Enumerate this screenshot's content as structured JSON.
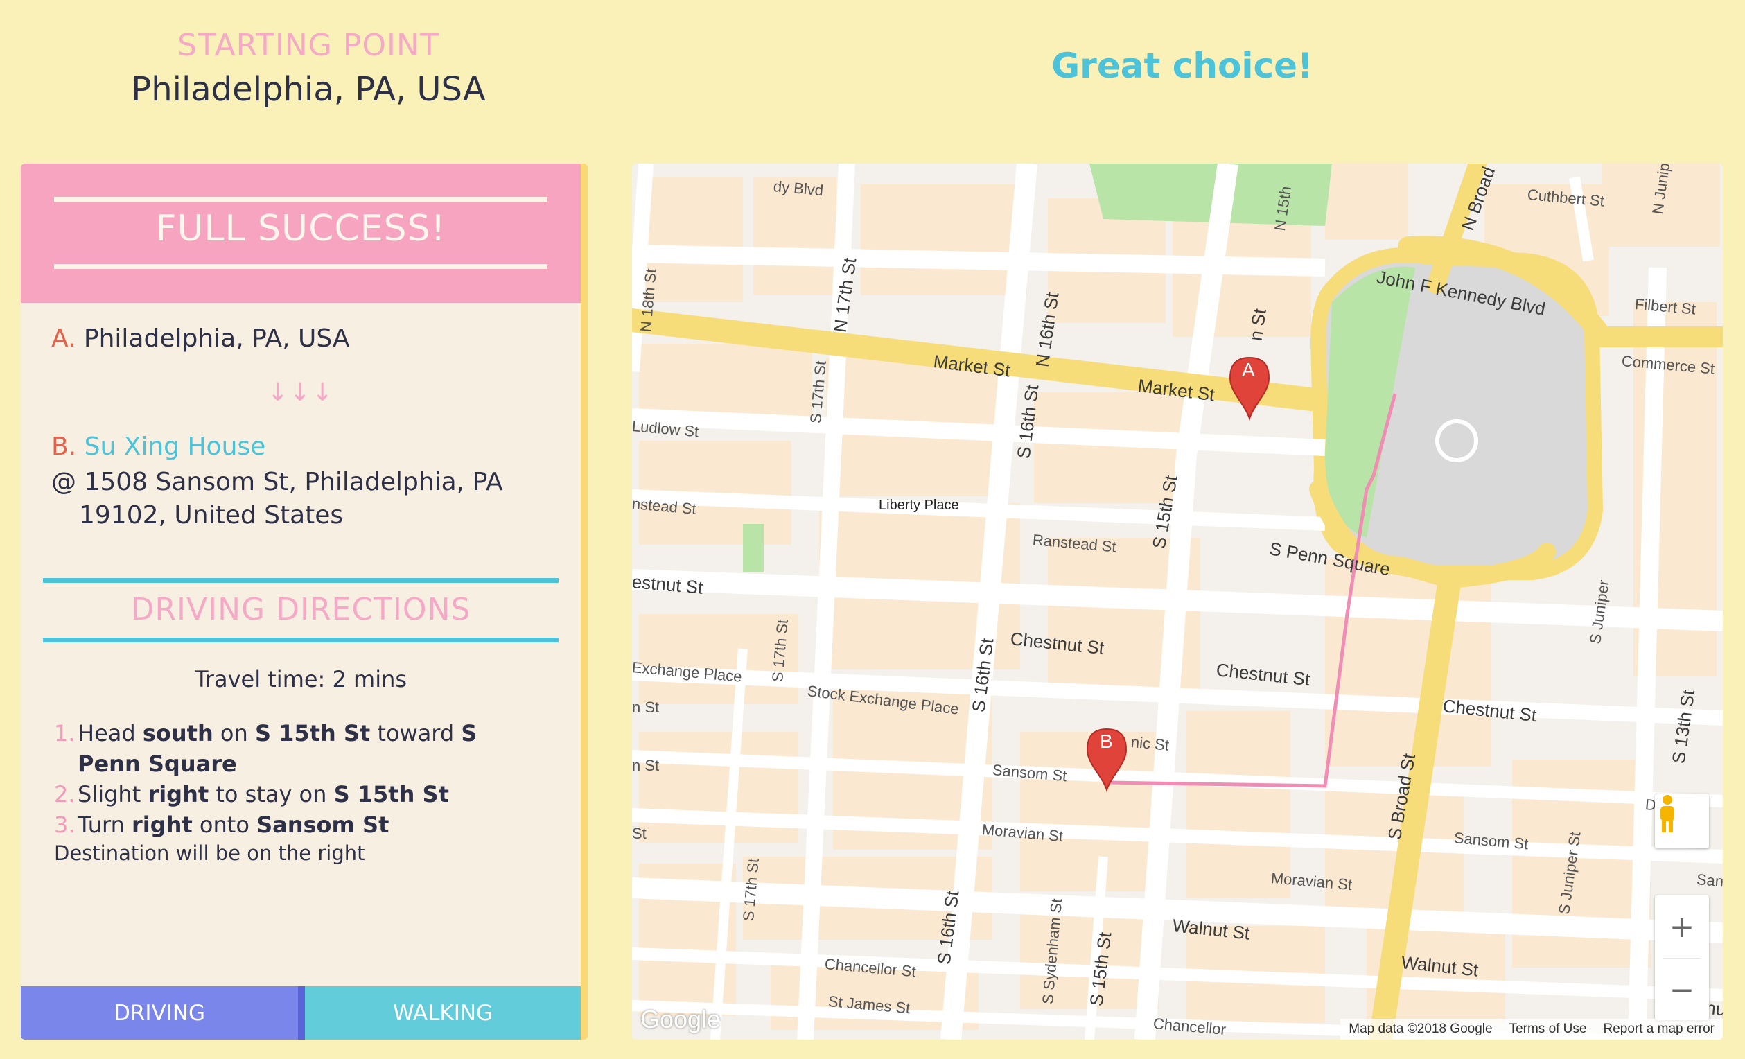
{
  "header": {
    "starting_label": "STARTING POINT",
    "starting_value": "Philadelphia, PA, USA",
    "choice_text": "Great choice!"
  },
  "panel": {
    "title": "FULL SUCCESS!",
    "origin_letter": "A.",
    "origin_address": "Philadelphia, PA, USA",
    "arrows": "↓↓↓",
    "dest_letter": "B.",
    "dest_name": "Su Xing House",
    "dest_address_line1": "@ 1508 Sansom St, Philadelphia, PA",
    "dest_address_line2": "19102, United States",
    "directions_title": "DRIVING DIRECTIONS",
    "travel_time": "Travel time: 2 mins",
    "steps": [
      {
        "num": "1.",
        "a": "Head ",
        "b": "south",
        "c": " on ",
        "d": "S 15th St",
        "e": " toward ",
        "f": "S Penn Square"
      },
      {
        "num": "2.",
        "a": "Slight ",
        "b": "right",
        "c": " to stay on ",
        "d": "S 15th St",
        "e": "",
        "f": ""
      },
      {
        "num": "3.",
        "a": "Turn ",
        "b": "right",
        "c": " onto ",
        "d": "Sansom St",
        "e": "",
        "f": ""
      }
    ],
    "destination_note": "Destination will be on the right",
    "modes": {
      "driving": "DRIVING",
      "walking": "WALKING"
    }
  },
  "map": {
    "streets": {
      "market_1": "Market St",
      "market_2": "Market St",
      "jfk": "John F Kennedy Blvd",
      "penn": "S Penn Square",
      "chestnut_1": "Chestnut St",
      "chestnut_2": "Chestnut St",
      "chestnut_3": "Chestnut St",
      "chestnut_4": "estnut St",
      "walnut_1": "Walnut St",
      "walnut_2": "Walnut St",
      "walnut_3": "Walnu",
      "ranstead_1": "Ranstead St",
      "ranstead_2": "nstead St",
      "ludlow": "Ludlow St",
      "sansom_1": "Sansom St",
      "sansom_2": "Sansom St",
      "moravian_1": "Moravian St",
      "moravian_2": "Moravian St",
      "stock_exchange": "Stock Exchange Place",
      "exchange": "Exchange Place",
      "chancellor_1": "Chancellor St",
      "chancellor_2": "Chancellor",
      "stjames": "St James St",
      "drury": "Drury S",
      "cuthbert": "Cuthbert St",
      "filbert": "Filbert St",
      "commerce": "Commerce St",
      "sans": "Sans",
      "n18": "N 18th St",
      "n17": "N 17th St",
      "n16": "N 16th St",
      "n15": "N 15th",
      "s17a": "S 17th St",
      "s17b": "S 17th St",
      "s17c": "S 17th St",
      "s16a": "S 16th St",
      "s16b": "S 16th St",
      "s16c": "S 16th St",
      "s15a": "S 15th St",
      "s15b": "S 15th St",
      "s15c": "n St",
      "sbroad": "S Broad St",
      "nbroad": "N Broad S",
      "njuniper": "N Juniper",
      "sjuniper_1": "S Juniper",
      "sjuniper_2": "S Juniper St",
      "s13": "S 13th St",
      "sydenham": "S Sydenham St",
      "dy_blvd": "dy Blvd",
      "n_st": "n St",
      "n_st2": "n St",
      "st": "St",
      "nic": "nic St"
    },
    "poi": "Liberty Place",
    "marker_a": "A",
    "marker_b": "B",
    "logo": "Google",
    "attribution": [
      "Map data ©2018 Google",
      "Terms of Use",
      "Report a map error"
    ],
    "zoom_in": "+",
    "zoom_out": "−"
  },
  "colors": {
    "background": "#f9f1b8",
    "pink": "#f6a9c6",
    "teal": "#4cc3d9",
    "route": "#f08db5",
    "driving": "#7a86e9",
    "walking": "#63ccdb",
    "marker": "#e0433a"
  }
}
